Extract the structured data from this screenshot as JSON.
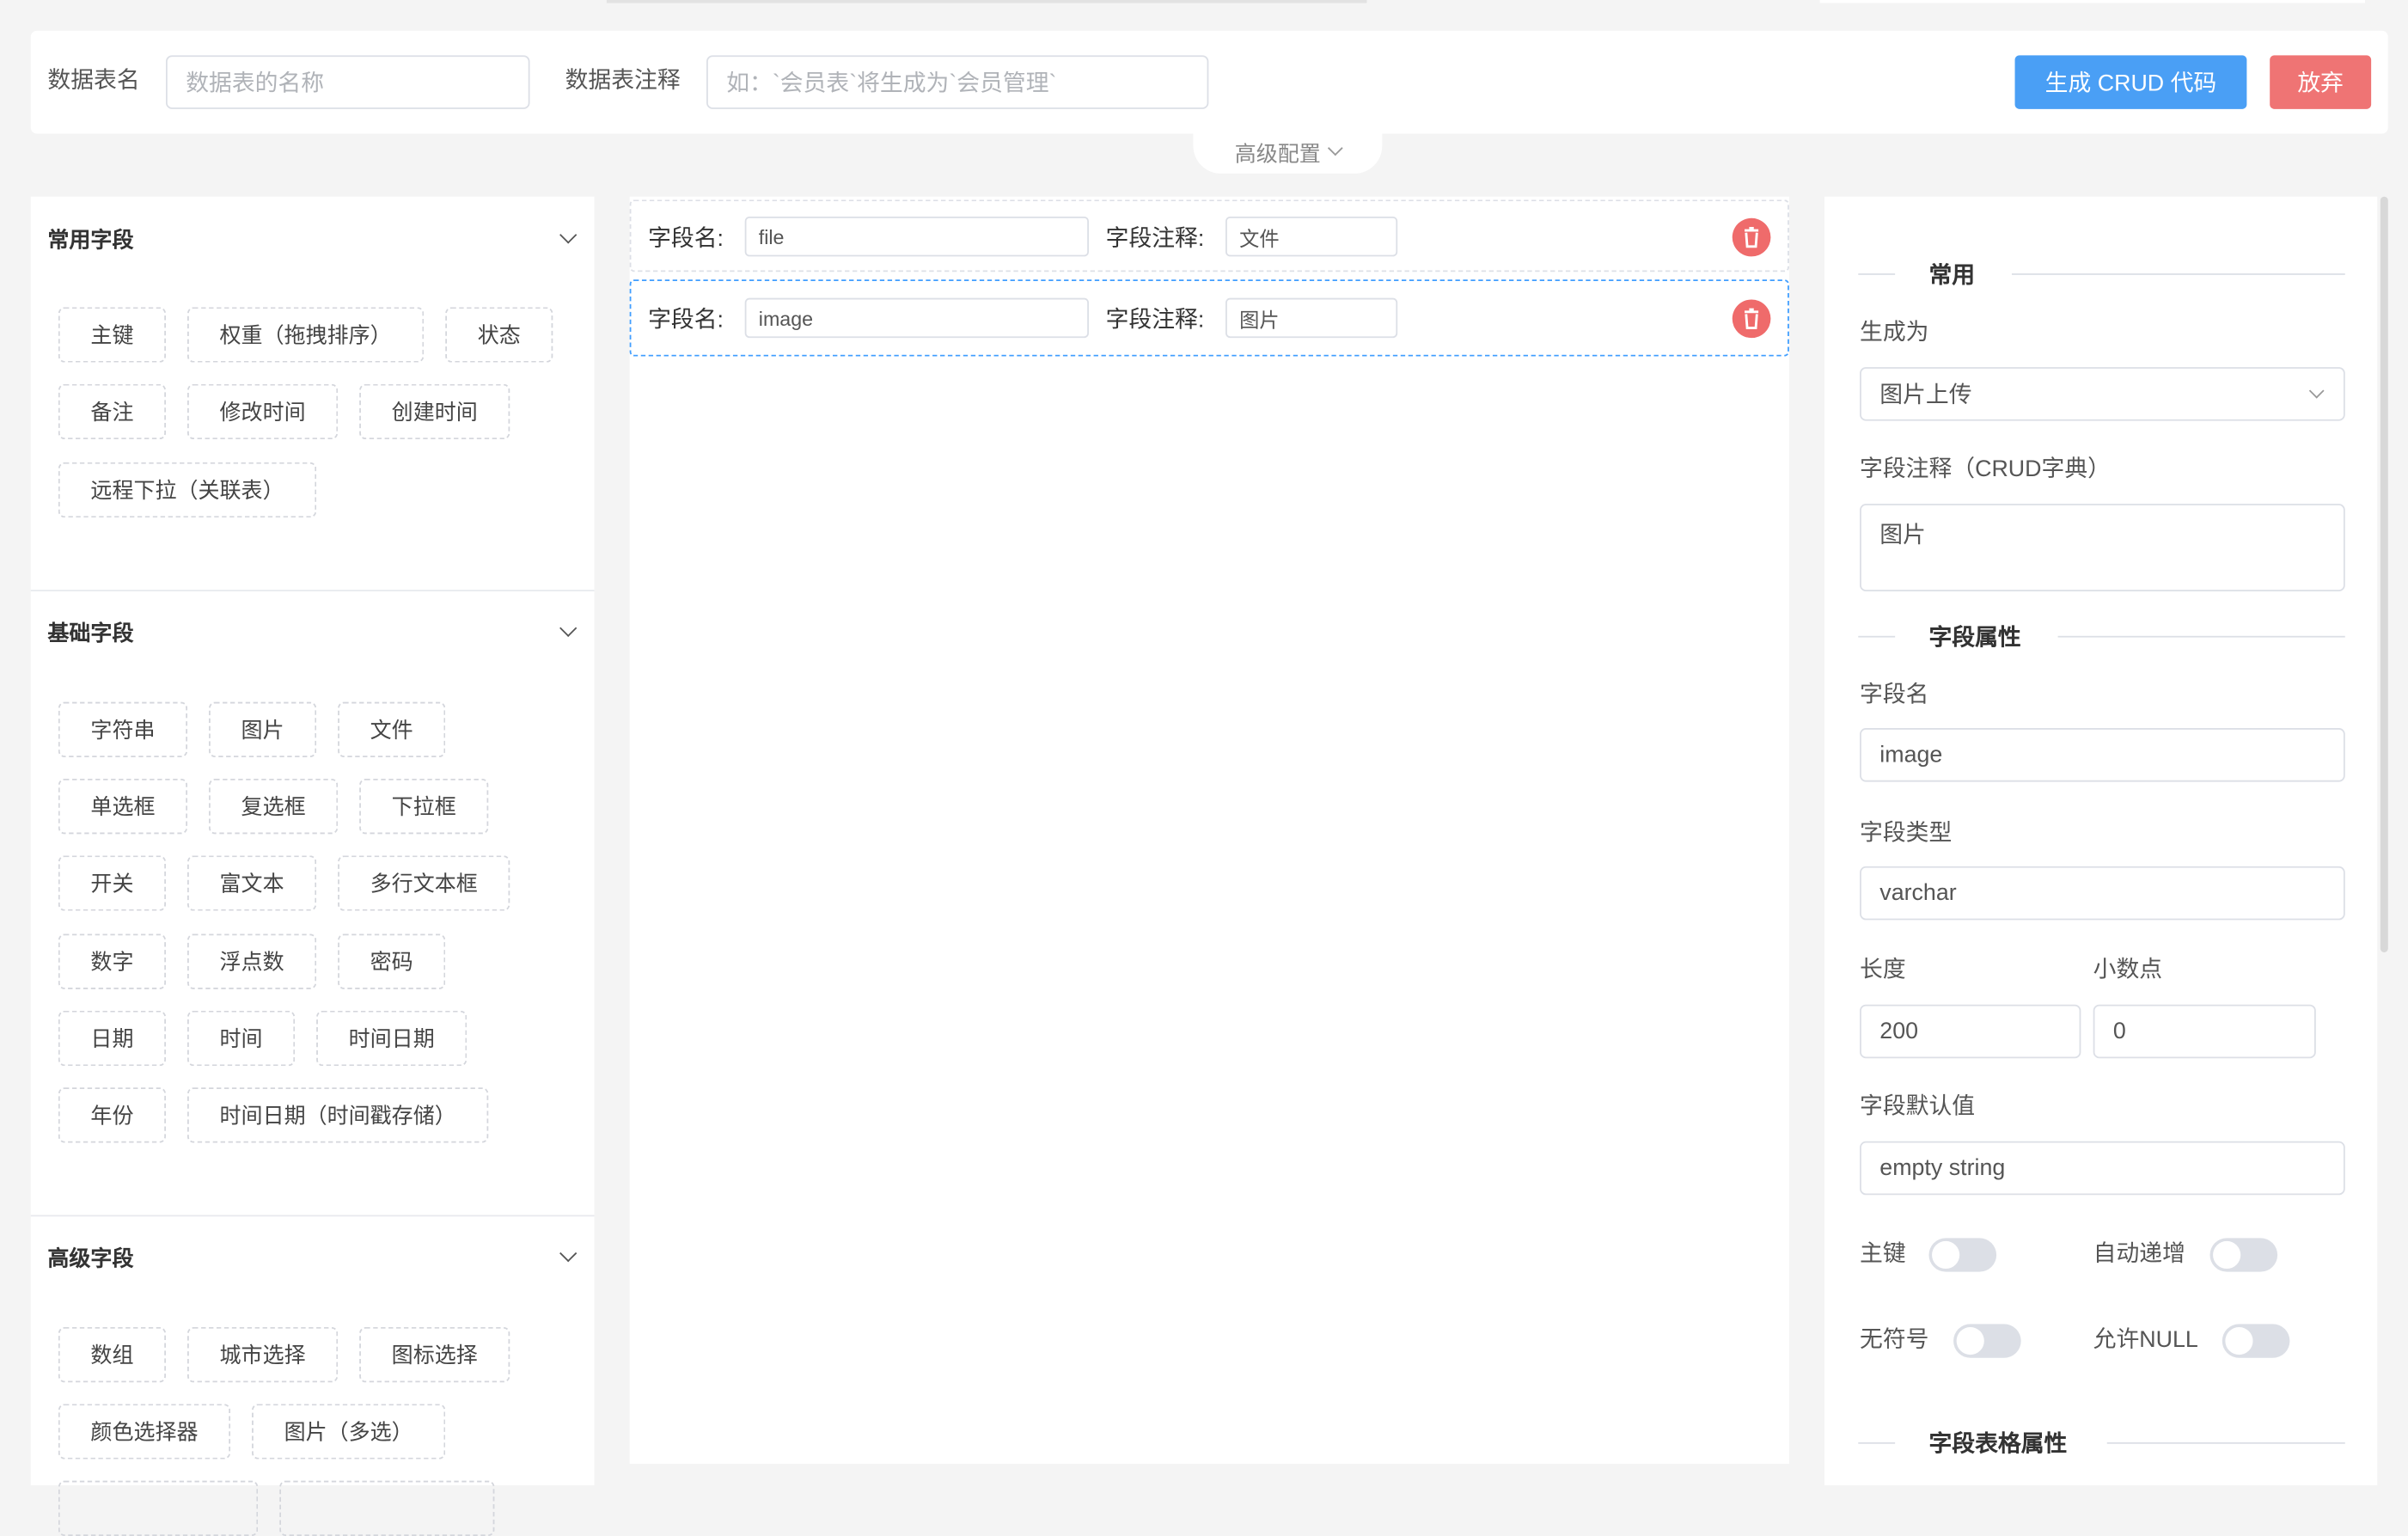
{
  "header": {
    "table_name_label": "数据表名",
    "table_name_placeholder": "数据表的名称",
    "table_comment_label": "数据表注释",
    "table_comment_placeholder": "如：`会员表`将生成为`会员管理`",
    "generate_button": "生成 CRUD 代码",
    "discard_button": "放弃",
    "advanced_toggle": "高级配置"
  },
  "colors": {
    "primary": "#409eff",
    "danger": "#ef6b6b"
  },
  "left": {
    "sections": [
      {
        "title": "常用字段",
        "rows": [
          [
            "主键",
            "权重（拖拽排序）",
            "状态"
          ],
          [
            "备注",
            "修改时间",
            "创建时间"
          ],
          [
            "远程下拉（关联表）"
          ]
        ]
      },
      {
        "title": "基础字段",
        "rows": [
          [
            "字符串",
            "图片",
            "文件"
          ],
          [
            "单选框",
            "复选框",
            "下拉框"
          ],
          [
            "开关",
            "富文本",
            "多行文本框"
          ],
          [
            "数字",
            "浮点数",
            "密码"
          ],
          [
            "日期",
            "时间",
            "时间日期"
          ],
          [
            "年份",
            "时间日期（时间戳存储）"
          ]
        ]
      },
      {
        "title": "高级字段",
        "rows": [
          [
            "数组",
            "城市选择",
            "图标选择"
          ],
          [
            "颜色选择器",
            "图片（多选）"
          ]
        ]
      }
    ]
  },
  "fields": {
    "name_label": "字段名:",
    "comment_label": "字段注释:",
    "items": [
      {
        "name": "file",
        "comment": "文件"
      },
      {
        "name": "image",
        "comment": "图片"
      }
    ]
  },
  "props": {
    "common_title": "常用",
    "generate_as_label": "生成为",
    "generate_as_value": "图片上传",
    "comment_label": "字段注释（CRUD字典）",
    "comment_value": "图片",
    "attr_title": "字段属性",
    "name_label": "字段名",
    "name_value": "image",
    "type_label": "字段类型",
    "type_value": "varchar",
    "length_label": "长度",
    "length_value": "200",
    "decimals_label": "小数点",
    "decimals_value": "0",
    "default_label": "字段默认值",
    "default_value": "empty string",
    "primary_key_label": "主键",
    "auto_increment_label": "自动递增",
    "unsigned_label": "无符号",
    "allow_null_label": "允许NULL",
    "table_attr_title": "字段表格属性"
  }
}
